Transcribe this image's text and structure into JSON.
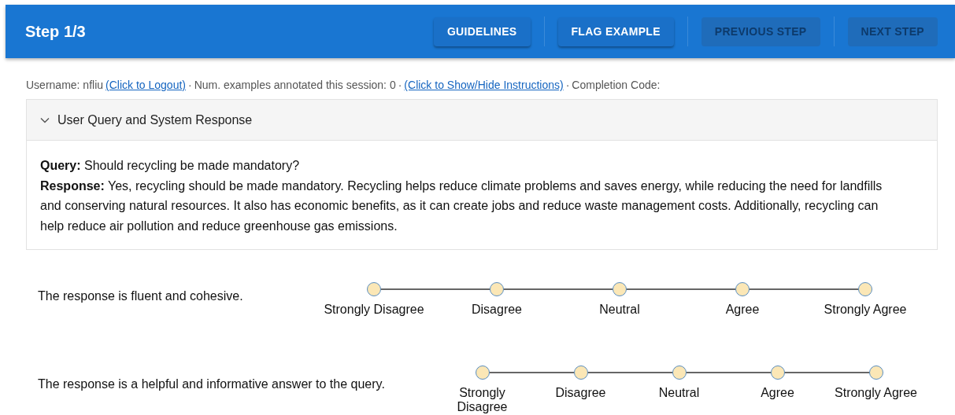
{
  "app_bar": {
    "title": "Step 1/3",
    "buttons": [
      {
        "label": "GUIDELINES",
        "disabled": false
      },
      {
        "label": "FLAG EXAMPLE",
        "disabled": false
      },
      {
        "label": "PREVIOUS STEP",
        "disabled": true
      },
      {
        "label": "NEXT STEP",
        "disabled": true
      }
    ]
  },
  "info_line": [
    {
      "kind": "text",
      "text": "Username: nfliu"
    },
    {
      "kind": "link",
      "text": "(Click to Logout)"
    },
    {
      "kind": "sep",
      "text": "·"
    },
    {
      "kind": "text",
      "text": "Num. examples annotated this session: 0"
    },
    {
      "kind": "sep",
      "text": "·"
    },
    {
      "kind": "link",
      "text": "(Click to Show/Hide Instructions)"
    },
    {
      "kind": "sep",
      "text": "·"
    },
    {
      "kind": "text",
      "text": "Completion Code:"
    }
  ],
  "panel": {
    "title": "User Query and System Response",
    "expanded": true,
    "paragraphs": [
      "**Query:** Should recycling be made mandatory?",
      "**Response:** Yes, recycling should be made mandatory. Recycling helps reduce climate problems and saves energy, while reducing the need for landfills and conserving natural resources. It also has economic benefits, as it can create jobs and reduce waste management costs. Additionally, recycling can help reduce air pollution and reduce greenhouse gas emissions."
    ]
  },
  "questions": [
    {
      "statement": "The response is fluent and cohesive.",
      "options": [
        {
          "label": "Strongly Disagree",
          "selected": false
        },
        {
          "label": "Disagree",
          "selected": false
        },
        {
          "label": "Neutral",
          "selected": false
        },
        {
          "label": "Agree",
          "selected": false
        },
        {
          "label": "Strongly Agree",
          "selected": false
        }
      ]
    },
    {
      "statement": "The response is a helpful and informative answer to the query.",
      "options": [
        {
          "label": "Strongly Disagree",
          "selected": false
        },
        {
          "label": "Disagree",
          "selected": false
        },
        {
          "label": "Neutral",
          "selected": false
        },
        {
          "label": "Agree",
          "selected": false
        },
        {
          "label": "Strongly Agree",
          "selected": false
        }
      ]
    }
  ]
}
